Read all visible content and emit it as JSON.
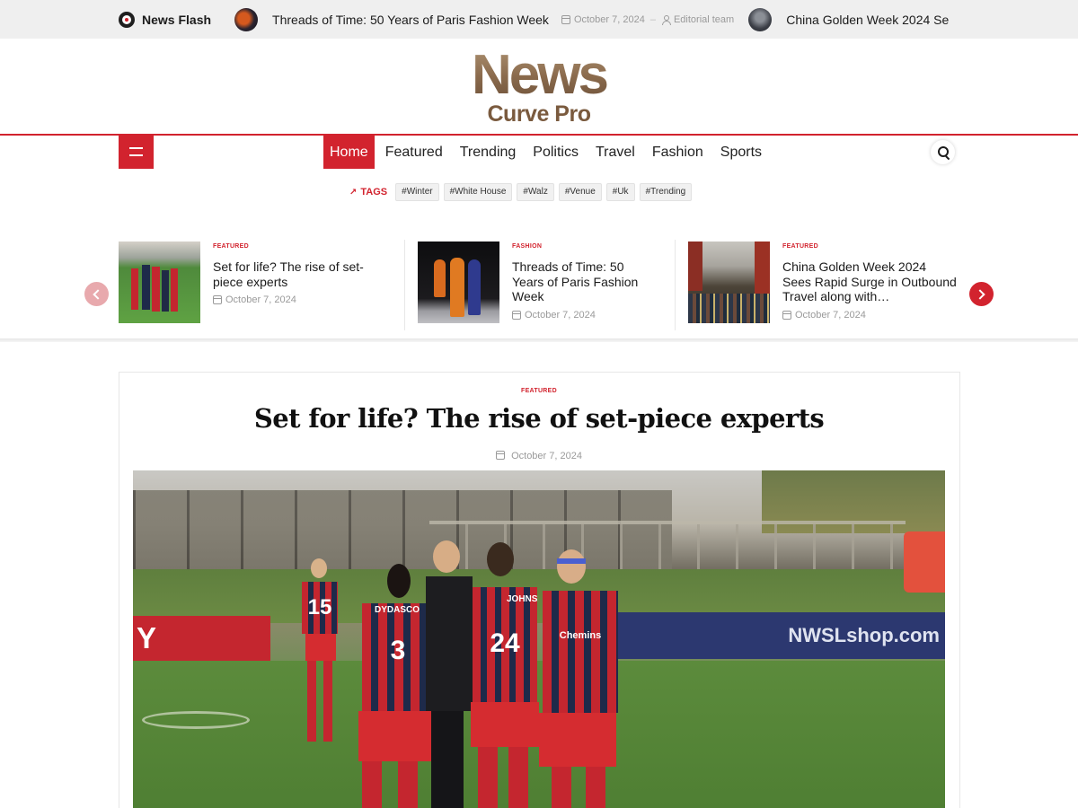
{
  "ticker": {
    "label": "News Flash",
    "items": [
      {
        "title": "Threads of Time: 50 Years of Paris Fashion Week",
        "date": "October 7, 2024",
        "author": "Editorial team"
      },
      {
        "title": "China Golden Week 2024 Se"
      }
    ]
  },
  "logo": {
    "top": "News",
    "bottom": "Curve Pro"
  },
  "nav": {
    "items": [
      "Home",
      "Featured",
      "Trending",
      "Politics",
      "Travel",
      "Fashion",
      "Sports"
    ],
    "active": "Home"
  },
  "tags": {
    "label": "TAGS",
    "items": [
      "#Winter",
      "#White House",
      "#Walz",
      "#Venue",
      "#Uk",
      "#Trending"
    ]
  },
  "slider": {
    "slides": [
      {
        "category": "FEATURED",
        "title": "Set for life? The rise of set-piece experts",
        "date": "October 7, 2024"
      },
      {
        "category": "FASHION",
        "title": "Threads of Time: 50 Years of Paris Fashion Week",
        "date": "October 7, 2024"
      },
      {
        "category": "FEATURED",
        "title": "China Golden Week 2024 Sees Rapid Surge in Outbound Travel along with…",
        "date": "October 7, 2024"
      }
    ]
  },
  "article": {
    "category": "FEATURED",
    "title": "Set for life? The rise of set-piece experts",
    "date": "October 7, 2024",
    "image_text": {
      "banner": "Y LEAGUE",
      "sign": "NWSLshop.com",
      "jersey_front": "3",
      "jersey_middle": "24",
      "jersey_back": "15",
      "name_left": "DYDASCO",
      "name_mid": "JOHNS",
      "sponsor": "Chemins"
    }
  },
  "colors": {
    "accent": "#d2232e",
    "logo_brown": "#7a5a3e",
    "ticker_bg": "#efefef"
  }
}
